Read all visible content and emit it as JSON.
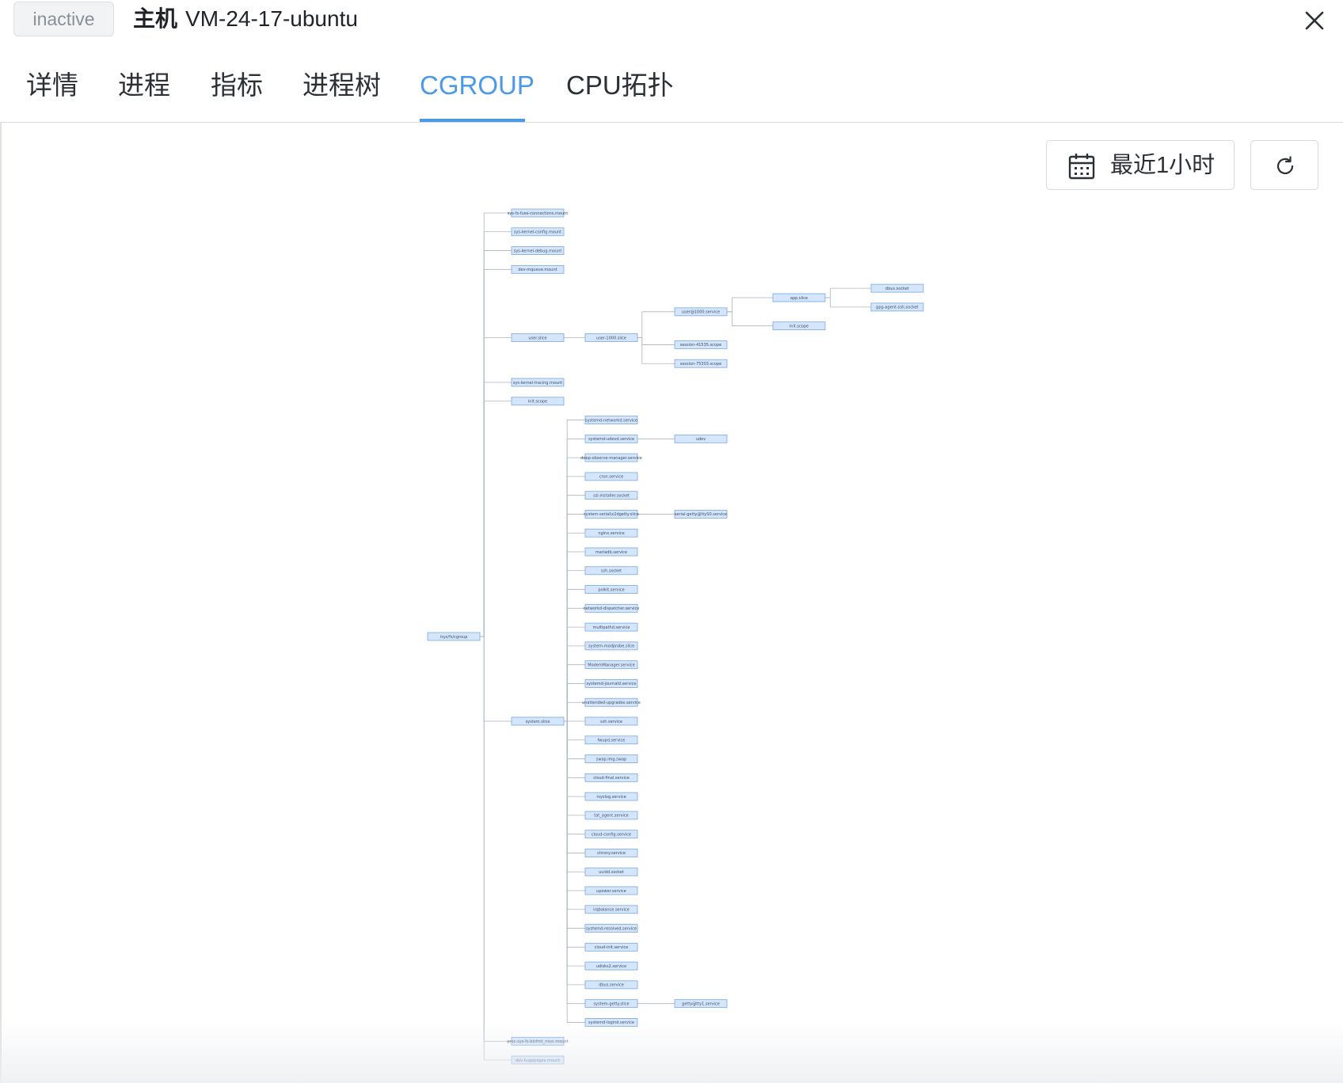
{
  "header": {
    "status": "inactive",
    "host_prefix": "主机",
    "host_name": "VM-24-17-ubuntu"
  },
  "tabs": [
    {
      "label": "详情"
    },
    {
      "label": "进程"
    },
    {
      "label": "指标"
    },
    {
      "label": "进程树"
    },
    {
      "label": "CGROUP"
    },
    {
      "label": "CPU拓扑"
    }
  ],
  "active_tab": "CGROUP",
  "toolbar": {
    "time_range": "最近1小时"
  },
  "colors": {
    "accent": "#4a9ae8",
    "node_fill": "#d5e6fb",
    "node_border": "#7aa7e2",
    "link": "#a9b4c2"
  },
  "icons": {
    "close": "close-icon",
    "calendar": "calendar-icon",
    "refresh": "refresh-icon"
  },
  "cgroup_tree": {
    "name": "/sys/fs/cgroup",
    "children": [
      {
        "name": "sys-fs-fuse-connections.mount"
      },
      {
        "name": "sys-kernel-config.mount"
      },
      {
        "name": "sys-kernel-debug.mount"
      },
      {
        "name": "dev-mqueue.mount"
      },
      {
        "name": "user.slice",
        "children": [
          {
            "name": "user-1000.slice",
            "children": [
              {
                "name": "user@1000.service",
                "children": [
                  {
                    "name": "app.slice",
                    "children": [
                      {
                        "name": "dbus.socket"
                      },
                      {
                        "name": "gpg-agent-ssh.socket"
                      }
                    ]
                  },
                  {
                    "name": "init.scope"
                  }
                ]
              },
              {
                "name": "session-41535.scope"
              },
              {
                "name": "session-75303.scope"
              }
            ]
          }
        ]
      },
      {
        "name": "sys-kernel-tracing.mount"
      },
      {
        "name": "init.scope"
      },
      {
        "name": "system.slice",
        "children": [
          {
            "name": "systemd-networkd.service"
          },
          {
            "name": "systemd-udevd.service",
            "children": [
              {
                "name": "udev"
              }
            ]
          },
          {
            "name": "deep-observe-manager.service"
          },
          {
            "name": "cron.service"
          },
          {
            "name": "ssl-installer.socket"
          },
          {
            "name": "system-serial\\x2dgetty.slice",
            "children": [
              {
                "name": "serial-getty@ttyS0.service"
              }
            ]
          },
          {
            "name": "nginx.service"
          },
          {
            "name": "mariadb.service"
          },
          {
            "name": "ssh.socket"
          },
          {
            "name": "polkit.service"
          },
          {
            "name": "networkd-dispatcher.service"
          },
          {
            "name": "multipathd.service"
          },
          {
            "name": "system-modprobe.slice"
          },
          {
            "name": "ModemManager.service"
          },
          {
            "name": "systemd-journald.service"
          },
          {
            "name": "unattended-upgrades.service"
          },
          {
            "name": "ssh.service"
          },
          {
            "name": "fwupd.service"
          },
          {
            "name": "swap.img.swap"
          },
          {
            "name": "cloud-final.service"
          },
          {
            "name": "rsyslog.service"
          },
          {
            "name": "tat_agent.service"
          },
          {
            "name": "cloud-config.service"
          },
          {
            "name": "chrony.service"
          },
          {
            "name": "uuidd.socket"
          },
          {
            "name": "upower.service"
          },
          {
            "name": "irqbalance.service"
          },
          {
            "name": "systemd-resolved.service"
          },
          {
            "name": "cloud-init.service"
          },
          {
            "name": "udisks2.service"
          },
          {
            "name": "dbus.service"
          },
          {
            "name": "system-getty.slice",
            "children": [
              {
                "name": "getty@tty1.service"
              }
            ]
          },
          {
            "name": "systemd-logind.service"
          }
        ]
      },
      {
        "name": "proc-sys-fs-binfmt_misc.mount"
      },
      {
        "name": "dev-hugepages.mount"
      }
    ]
  }
}
